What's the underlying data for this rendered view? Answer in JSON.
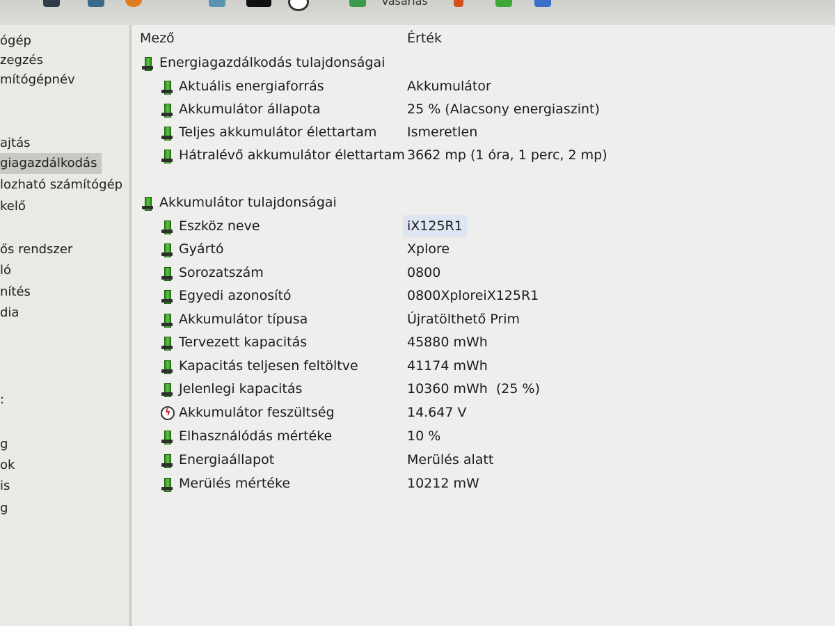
{
  "sidebar": {
    "items": [
      {
        "label": "ógép",
        "selected": false
      },
      {
        "label": "zegzés",
        "selected": false
      },
      {
        "label": "mítógépnév",
        "selected": false
      },
      {
        "label": "ajtás",
        "selected": false
      },
      {
        "label": "giagazdálkodás",
        "selected": true
      },
      {
        "label": "lozható számítógép",
        "selected": false
      },
      {
        "label": "kelő",
        "selected": false
      },
      {
        "label": "ős rendszer",
        "selected": false
      },
      {
        "label": "ló",
        "selected": false
      },
      {
        "label": "nítés",
        "selected": false
      },
      {
        "label": "dia",
        "selected": false
      },
      {
        "label": ":",
        "selected": false
      },
      {
        "label": "g",
        "selected": false
      },
      {
        "label": "ok",
        "selected": false
      },
      {
        "label": "is",
        "selected": false
      },
      {
        "label": "g",
        "selected": false
      }
    ]
  },
  "columns": {
    "field": "Mező",
    "value": "Érték"
  },
  "sections": [
    {
      "title": "Energiagazdálkodás tulajdonságai",
      "rows": [
        {
          "field": "Aktuális energiaforrás",
          "value": "Akkumulátor",
          "icon": "battery-icon"
        },
        {
          "field": "Akkumulátor állapota",
          "value": "25 % (Alacsony energiaszint)",
          "icon": "battery-icon"
        },
        {
          "field": "Teljes akkumulátor élettartam",
          "value": "Ismeretlen",
          "icon": "battery-icon"
        },
        {
          "field": "Hátralévő akkumulátor élettartam",
          "value": "3662 mp (1 óra, 1 perc, 2 mp)",
          "icon": "battery-icon"
        }
      ]
    },
    {
      "title": "Akkumulátor tulajdonságai",
      "rows": [
        {
          "field": "Eszköz neve",
          "value": "iX125R1",
          "icon": "battery-icon"
        },
        {
          "field": "Gyártó",
          "value": "Xplore",
          "icon": "battery-icon"
        },
        {
          "field": "Sorozatszám",
          "value": "0800",
          "icon": "battery-icon"
        },
        {
          "field": "Egyedi azonosító",
          "value": "0800XploreiX125R1",
          "icon": "battery-icon"
        },
        {
          "field": "Akkumulátor típusa",
          "value": "Újratölthető Prim",
          "icon": "battery-icon"
        },
        {
          "field": "Tervezett kapacitás",
          "value": "45880 mWh",
          "icon": "battery-icon"
        },
        {
          "field": "Kapacitás teljesen feltöltve",
          "value": "41174 mWh",
          "icon": "battery-icon"
        },
        {
          "field": "Jelenlegi kapacitás",
          "value": "10360 mWh  (25 %)",
          "icon": "battery-icon"
        },
        {
          "field": "Akkumulátor feszültség",
          "value": "14.647 V",
          "icon": "voltage-icon"
        },
        {
          "field": "Elhasználódás mértéke",
          "value": "10 %",
          "icon": "battery-icon"
        },
        {
          "field": "Energiaállapot",
          "value": "Merülés alatt",
          "icon": "battery-icon"
        },
        {
          "field": "Merülés mértéke",
          "value": "10212 mW",
          "icon": "battery-icon"
        }
      ]
    }
  ],
  "toolbar": {
    "partial_text": "Vásárlás"
  },
  "colors": {
    "icon_green": "#4cb832",
    "selection": "#c8c8c4",
    "panel": "#eeeeec"
  }
}
